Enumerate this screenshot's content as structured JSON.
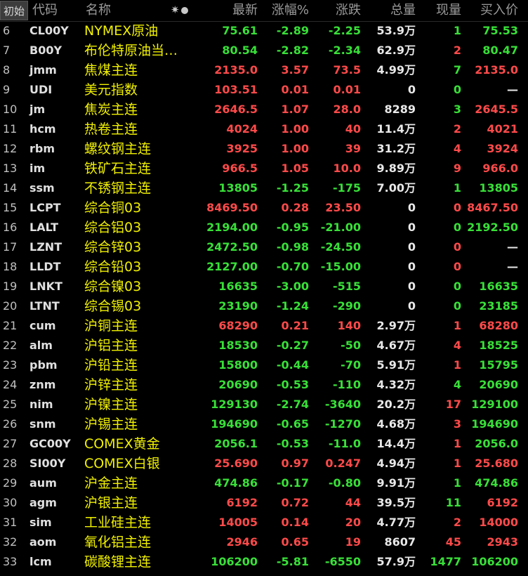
{
  "header": {
    "tab": "初始",
    "code": "代码",
    "name": "名称",
    "last": "最新",
    "pct": "涨幅%",
    "chg": "涨跌",
    "vol": "总量",
    "cur": "现量",
    "bid": "买入价",
    "settings_icon": "gear-icon"
  },
  "colors": {
    "up": "#ff4a4a",
    "down": "#38e038",
    "name": "#f0f000",
    "background": "#000000"
  },
  "rows": [
    {
      "idx": "6",
      "code": "CL00Y",
      "name": "NYMEX原油",
      "last": "75.61",
      "pct": "-2.89",
      "chg": "-2.25",
      "vol": "53.9万",
      "cur": "1",
      "bid": "75.53",
      "dir": "down",
      "cur_dir": "down",
      "bid_dir": "down"
    },
    {
      "idx": "7",
      "code": "B00Y",
      "name": "布伦特原油当…",
      "last": "80.54",
      "pct": "-2.82",
      "chg": "-2.34",
      "vol": "62.9万",
      "cur": "2",
      "bid": "80.47",
      "dir": "down",
      "cur_dir": "up",
      "bid_dir": "down"
    },
    {
      "idx": "8",
      "code": "jmm",
      "name": "焦煤主连",
      "last": "2135.0",
      "pct": "3.57",
      "chg": "73.5",
      "vol": "4.99万",
      "cur": "7",
      "bid": "2135.0",
      "dir": "up",
      "cur_dir": "down",
      "bid_dir": "up"
    },
    {
      "idx": "9",
      "code": "UDI",
      "name": "美元指数",
      "last": "103.51",
      "pct": "0.01",
      "chg": "0.01",
      "vol": "0",
      "cur": "0",
      "bid": "—",
      "dir": "up",
      "cur_dir": "down",
      "bid_dir": "flat"
    },
    {
      "idx": "10",
      "code": "jm",
      "name": "焦炭主连",
      "last": "2646.5",
      "pct": "1.07",
      "chg": "28.0",
      "vol": "8289",
      "cur": "3",
      "bid": "2645.5",
      "dir": "up",
      "cur_dir": "down",
      "bid_dir": "up"
    },
    {
      "idx": "11",
      "code": "hcm",
      "name": "热卷主连",
      "last": "4024",
      "pct": "1.00",
      "chg": "40",
      "vol": "11.4万",
      "cur": "2",
      "bid": "4021",
      "dir": "up",
      "cur_dir": "up",
      "bid_dir": "up"
    },
    {
      "idx": "12",
      "code": "rbm",
      "name": "螺纹钢主连",
      "last": "3925",
      "pct": "1.00",
      "chg": "39",
      "vol": "31.2万",
      "cur": "4",
      "bid": "3924",
      "dir": "up",
      "cur_dir": "up",
      "bid_dir": "up"
    },
    {
      "idx": "13",
      "code": "im",
      "name": "铁矿石主连",
      "last": "966.5",
      "pct": "1.05",
      "chg": "10.0",
      "vol": "9.89万",
      "cur": "9",
      "bid": "966.0",
      "dir": "up",
      "cur_dir": "up",
      "bid_dir": "up"
    },
    {
      "idx": "14",
      "code": "ssm",
      "name": "不锈钢主连",
      "last": "13805",
      "pct": "-1.25",
      "chg": "-175",
      "vol": "7.00万",
      "cur": "1",
      "bid": "13805",
      "dir": "down",
      "cur_dir": "down",
      "bid_dir": "down"
    },
    {
      "idx": "15",
      "code": "LCPT",
      "name": "综合铜03",
      "last": "8469.50",
      "pct": "0.28",
      "chg": "23.50",
      "vol": "0",
      "cur": "0",
      "bid": "8467.50",
      "dir": "up",
      "cur_dir": "up",
      "bid_dir": "up"
    },
    {
      "idx": "16",
      "code": "LALT",
      "name": "综合铝03",
      "last": "2194.00",
      "pct": "-0.95",
      "chg": "-21.00",
      "vol": "0",
      "cur": "0",
      "bid": "2192.50",
      "dir": "down",
      "cur_dir": "down",
      "bid_dir": "down"
    },
    {
      "idx": "17",
      "code": "LZNT",
      "name": "综合锌03",
      "last": "2472.50",
      "pct": "-0.98",
      "chg": "-24.50",
      "vol": "0",
      "cur": "0",
      "bid": "—",
      "dir": "down",
      "cur_dir": "up",
      "bid_dir": "flat"
    },
    {
      "idx": "18",
      "code": "LLDT",
      "name": "综合铅03",
      "last": "2127.00",
      "pct": "-0.70",
      "chg": "-15.00",
      "vol": "0",
      "cur": "0",
      "bid": "—",
      "dir": "down",
      "cur_dir": "up",
      "bid_dir": "flat"
    },
    {
      "idx": "19",
      "code": "LNKT",
      "name": "综合镍03",
      "last": "16635",
      "pct": "-3.00",
      "chg": "-515",
      "vol": "0",
      "cur": "0",
      "bid": "16635",
      "dir": "down",
      "cur_dir": "down",
      "bid_dir": "down"
    },
    {
      "idx": "20",
      "code": "LTNT",
      "name": "综合锡03",
      "last": "23190",
      "pct": "-1.24",
      "chg": "-290",
      "vol": "0",
      "cur": "0",
      "bid": "23185",
      "dir": "down",
      "cur_dir": "down",
      "bid_dir": "down"
    },
    {
      "idx": "21",
      "code": "cum",
      "name": "沪铜主连",
      "last": "68290",
      "pct": "0.21",
      "chg": "140",
      "vol": "2.97万",
      "cur": "1",
      "bid": "68280",
      "dir": "up",
      "cur_dir": "up",
      "bid_dir": "up"
    },
    {
      "idx": "22",
      "code": "alm",
      "name": "沪铝主连",
      "last": "18530",
      "pct": "-0.27",
      "chg": "-50",
      "vol": "4.67万",
      "cur": "4",
      "bid": "18525",
      "dir": "down",
      "cur_dir": "up",
      "bid_dir": "down"
    },
    {
      "idx": "23",
      "code": "pbm",
      "name": "沪铅主连",
      "last": "15800",
      "pct": "-0.44",
      "chg": "-70",
      "vol": "5.91万",
      "cur": "1",
      "bid": "15795",
      "dir": "down",
      "cur_dir": "up",
      "bid_dir": "down"
    },
    {
      "idx": "24",
      "code": "znm",
      "name": "沪锌主连",
      "last": "20690",
      "pct": "-0.53",
      "chg": "-110",
      "vol": "4.32万",
      "cur": "4",
      "bid": "20690",
      "dir": "down",
      "cur_dir": "down",
      "bid_dir": "down"
    },
    {
      "idx": "25",
      "code": "nim",
      "name": "沪镍主连",
      "last": "129130",
      "pct": "-2.74",
      "chg": "-3640",
      "vol": "20.2万",
      "cur": "17",
      "bid": "129100",
      "dir": "down",
      "cur_dir": "up",
      "bid_dir": "down"
    },
    {
      "idx": "26",
      "code": "snm",
      "name": "沪锡主连",
      "last": "194690",
      "pct": "-0.65",
      "chg": "-1270",
      "vol": "4.68万",
      "cur": "3",
      "bid": "194690",
      "dir": "down",
      "cur_dir": "up",
      "bid_dir": "down"
    },
    {
      "idx": "27",
      "code": "GC00Y",
      "name": "COMEX黄金",
      "last": "2056.1",
      "pct": "-0.53",
      "chg": "-11.0",
      "vol": "14.4万",
      "cur": "1",
      "bid": "2056.0",
      "dir": "down",
      "cur_dir": "up",
      "bid_dir": "down"
    },
    {
      "idx": "28",
      "code": "SI00Y",
      "name": "COMEX白银",
      "last": "25.690",
      "pct": "0.97",
      "chg": "0.247",
      "vol": "4.94万",
      "cur": "1",
      "bid": "25.680",
      "dir": "up",
      "cur_dir": "up",
      "bid_dir": "up"
    },
    {
      "idx": "29",
      "code": "aum",
      "name": "沪金主连",
      "last": "474.86",
      "pct": "-0.17",
      "chg": "-0.80",
      "vol": "9.91万",
      "cur": "1",
      "bid": "474.86",
      "dir": "down",
      "cur_dir": "down",
      "bid_dir": "down"
    },
    {
      "idx": "30",
      "code": "agm",
      "name": "沪银主连",
      "last": "6192",
      "pct": "0.72",
      "chg": "44",
      "vol": "39.5万",
      "cur": "11",
      "bid": "6192",
      "dir": "up",
      "cur_dir": "down",
      "bid_dir": "up"
    },
    {
      "idx": "31",
      "code": "sim",
      "name": "工业硅主连",
      "last": "14005",
      "pct": "0.14",
      "chg": "20",
      "vol": "4.77万",
      "cur": "2",
      "bid": "14000",
      "dir": "up",
      "cur_dir": "up",
      "bid_dir": "up"
    },
    {
      "idx": "32",
      "code": "aom",
      "name": "氧化铝主连",
      "last": "2946",
      "pct": "0.65",
      "chg": "19",
      "vol": "8607",
      "cur": "45",
      "bid": "2943",
      "dir": "up",
      "cur_dir": "up",
      "bid_dir": "up"
    },
    {
      "idx": "33",
      "code": "lcm",
      "name": "碳酸锂主连",
      "last": "106200",
      "pct": "-5.81",
      "chg": "-6550",
      "vol": "57.9万",
      "cur": "1477",
      "bid": "106200",
      "dir": "down",
      "cur_dir": "down",
      "bid_dir": "down"
    }
  ]
}
